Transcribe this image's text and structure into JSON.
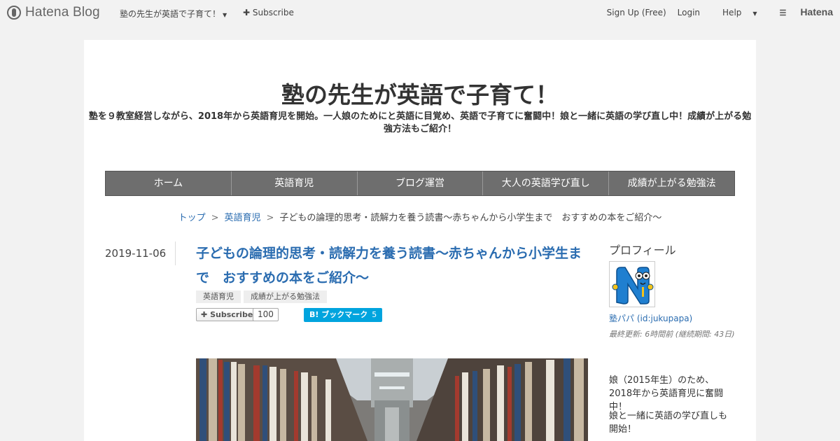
{
  "topbar": {
    "logo_text": "Hatena Blog",
    "blog_menu_label": "塾の先生が英語で子育て！",
    "subscribe_label": "Subscribe",
    "signup_label": "Sign Up (Free)",
    "login_label": "Login",
    "help_label": "Help",
    "hatena_label": "Hatena"
  },
  "header": {
    "title": "塾の先生が英語で子育て！",
    "description": "塾を９教室経営しながら、2018年から英語育児を開始。一人娘のためにと英語に目覚め、英語で子育てに奮闘中！娘と一緒に英語の学び直し中！成績が上がる勉強方法もご紹介！"
  },
  "nav": {
    "items": [
      {
        "label": "ホーム"
      },
      {
        "label": "英語育児"
      },
      {
        "label": "ブログ運営"
      },
      {
        "label": "大人の英語学び直し"
      },
      {
        "label": "成績が上がる勉強法"
      }
    ]
  },
  "breadcrumb": {
    "top": "トップ",
    "category": "英語育児",
    "current": "子どもの論理的思考・読解力を養う読書～赤ちゃんから小学生まで　おすすめの本をご紹介～",
    "separator": ">"
  },
  "entry": {
    "date": "2019-11-06",
    "title": "子どもの論理的思考・読解力を養う読書～赤ちゃんから小学生まで　おすすめの本をご紹介～",
    "categories": [
      "英語育児",
      "成績が上がる勉強法"
    ],
    "subscribe_label": "Subscribe",
    "subscribe_count": "100",
    "bookmark_label": "B! ブックマーク",
    "bookmark_count": "5"
  },
  "sidebar": {
    "profile_heading": "プロフィール",
    "user_name": "塾パパ (id:jukupapa)",
    "last_updated": "最終更新: 6時間前 (継続期間: 43日)",
    "intro_1": "娘（2015年生）のため、2018年から英語育児に奮闘中！",
    "intro_2": "娘と一緒に英語の学び直しも開始！"
  },
  "colors": {
    "link": "#2a6cb0",
    "nav_bg": "#6e6e6e",
    "bookmark_bg": "#00a4de",
    "page_bg": "#f2f2f2"
  }
}
